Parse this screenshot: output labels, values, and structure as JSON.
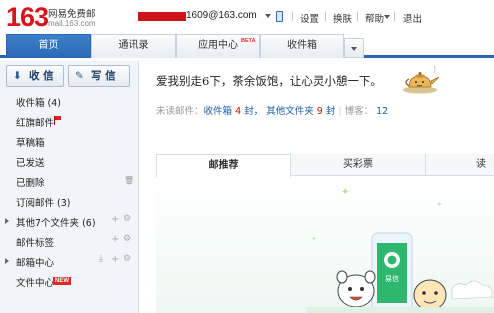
{
  "header": {
    "logo_number": "163",
    "logo_name": "网易免费邮",
    "logo_domain": "mail.163.com",
    "account": "1609@163.com",
    "links": [
      "设置",
      "换肤",
      "帮助",
      "退出"
    ],
    "separators": [
      "|",
      "|",
      "|",
      "|"
    ]
  },
  "tabs": [
    {
      "label": "首页",
      "active": true
    },
    {
      "label": "通讯录",
      "active": false
    },
    {
      "label": "应用中心",
      "active": false,
      "badge": "BETA"
    },
    {
      "label": "收件箱",
      "active": false
    }
  ],
  "sidebar": {
    "receive_button": "收 信",
    "write_button": "写 信",
    "items": [
      {
        "label": "收件箱 (4)"
      },
      {
        "label": "红旗邮件"
      },
      {
        "label": "草稿箱"
      },
      {
        "label": "已发送"
      },
      {
        "label": "已删除"
      },
      {
        "label": "订阅邮件 (3)"
      },
      {
        "label": "其他7个文件夹 (6)"
      },
      {
        "label": "邮件标签"
      },
      {
        "label": "邮箱中心"
      },
      {
        "label": "文件中心",
        "badge": "NEW"
      }
    ]
  },
  "main": {
    "greeting": "爱我别走6下，茶余饭饱，让心灵小憩一下。",
    "stats": {
      "unread_label": "未读邮件：",
      "inbox_label": "收件箱",
      "inbox_count": "4",
      "unit1": "封，",
      "other_label": "其他文件夹",
      "other_count": "9",
      "unit2": "封",
      "sep": "|",
      "blog_label": "博客：",
      "blog_count": "12"
    },
    "content_tabs": [
      "邮推荐",
      "买彩票",
      "读书"
    ],
    "app_label": "易信"
  },
  "colors": {
    "brand_red": "#d8141c",
    "nav_blue": "#2968b6",
    "link_blue": "#1d5aa6",
    "count_red": "#d01010",
    "app_green": "#2ab16a"
  }
}
